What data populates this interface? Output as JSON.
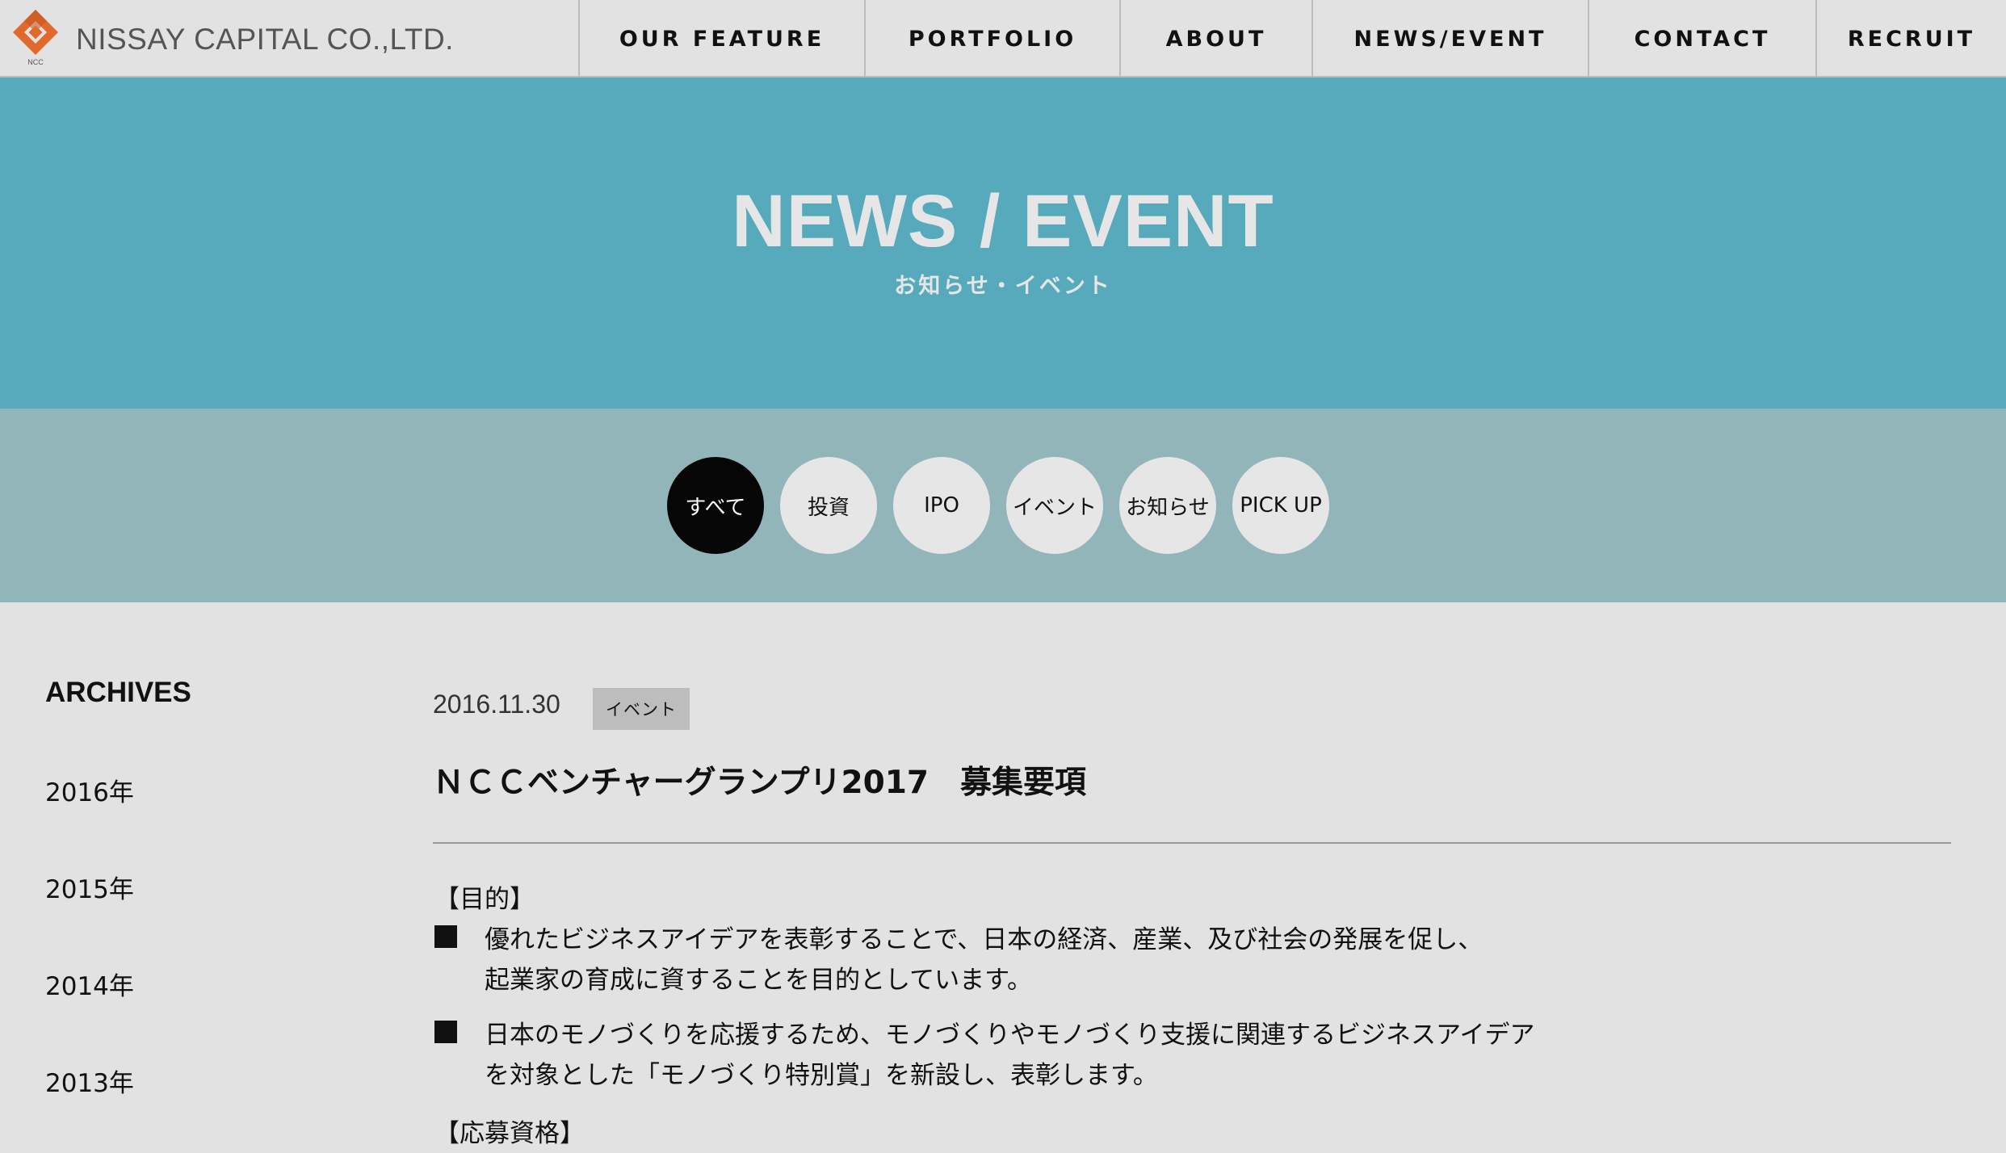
{
  "brand": {
    "name": "NISSAY CAPITAL CO.,LTD.",
    "mark_caption": "NCC",
    "colors": {
      "orange": "#e06a2c",
      "teal": "#56aabc",
      "sage": "#92b5b9"
    }
  },
  "nav": {
    "items": [
      {
        "label": "OUR FEATURE"
      },
      {
        "label": "PORTFOLIO"
      },
      {
        "label": "ABOUT"
      },
      {
        "label": "NEWS/EVENT"
      },
      {
        "label": "CONTACT"
      },
      {
        "label": "RECRUIT"
      }
    ]
  },
  "hero": {
    "title": "NEWS / EVENT",
    "subtitle": "お知らせ・イベント"
  },
  "filters": {
    "items": [
      {
        "label": "すべて",
        "active": true
      },
      {
        "label": "投資",
        "active": false
      },
      {
        "label": "IPO",
        "active": false
      },
      {
        "label": "イベント",
        "active": false
      },
      {
        "label": "お知らせ",
        "active": false
      },
      {
        "label": "PICK UP",
        "active": false
      }
    ]
  },
  "sidebar": {
    "title": "ARCHIVES",
    "years": [
      "2016年",
      "2015年",
      "2014年",
      "2013年"
    ]
  },
  "post": {
    "date": "2016.11.30",
    "tag": "イベント",
    "title": "ＮＣＣベンチャーグランプリ2017　募集要項",
    "sections": {
      "purpose_heading": "【目的】",
      "bullet1_line1": "優れたビジネスアイデアを表彰することで、日本の経済、産業、及び社会の発展を促し、",
      "bullet1_line2": "起業家の育成に資することを目的としています。",
      "bullet2_line1": "日本のモノづくりを応援するため、モノづくりやモノづくり支援に関連するビジネスアイデア",
      "bullet2_line2": "を対象とした「モノづくり特別賞」を新設し、表彰します。",
      "eligibility_heading": "【応募資格】"
    }
  }
}
